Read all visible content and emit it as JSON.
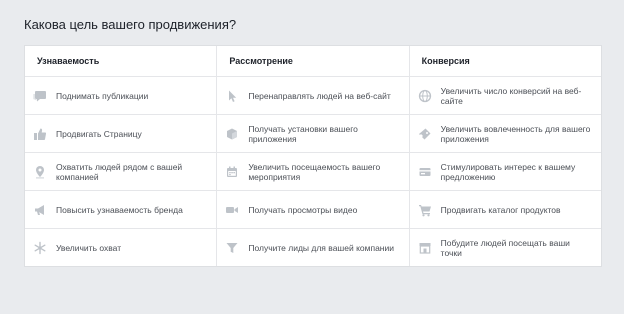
{
  "question": "Какова цель вашего продвижения?",
  "icon_color": "#bec3c9",
  "columns": [
    {
      "title": "Узнаваемость",
      "items": [
        {
          "label": "Поднимать публикации",
          "icon": "speech-bubble-icon"
        },
        {
          "label": "Продвигать Страницу",
          "icon": "thumbs-up-icon"
        },
        {
          "label": "Охватить людей рядом с вашей компанией",
          "icon": "map-pin-icon"
        },
        {
          "label": "Повысить узнаваемость бренда",
          "icon": "megaphone-icon"
        },
        {
          "label": "Увеличить охват",
          "icon": "snowflake-icon"
        }
      ]
    },
    {
      "title": "Рассмотрение",
      "items": [
        {
          "label": "Перенаправлять людей на веб-сайт",
          "icon": "cursor-icon"
        },
        {
          "label": "Получать установки вашего приложения",
          "icon": "box-icon"
        },
        {
          "label": "Увеличить посещаемость вашего мероприятия",
          "icon": "calendar-icon"
        },
        {
          "label": "Получать просмотры видео",
          "icon": "video-camera-icon"
        },
        {
          "label": "Получите лиды для вашей компании",
          "icon": "funnel-icon"
        }
      ]
    },
    {
      "title": "Конверсия",
      "items": [
        {
          "label": "Увеличить число конверсий на веб-сайте",
          "icon": "globe-icon"
        },
        {
          "label": "Увеличить вовлеченность для вашего приложения",
          "icon": "gamepad-icon"
        },
        {
          "label": "Стимулировать интерес к вашему предложению",
          "icon": "offer-card-icon"
        },
        {
          "label": "Продвигать каталог продуктов",
          "icon": "shopping-cart-icon"
        },
        {
          "label": "Побудите людей посещать ваши точки",
          "icon": "storefront-icon"
        }
      ]
    }
  ]
}
